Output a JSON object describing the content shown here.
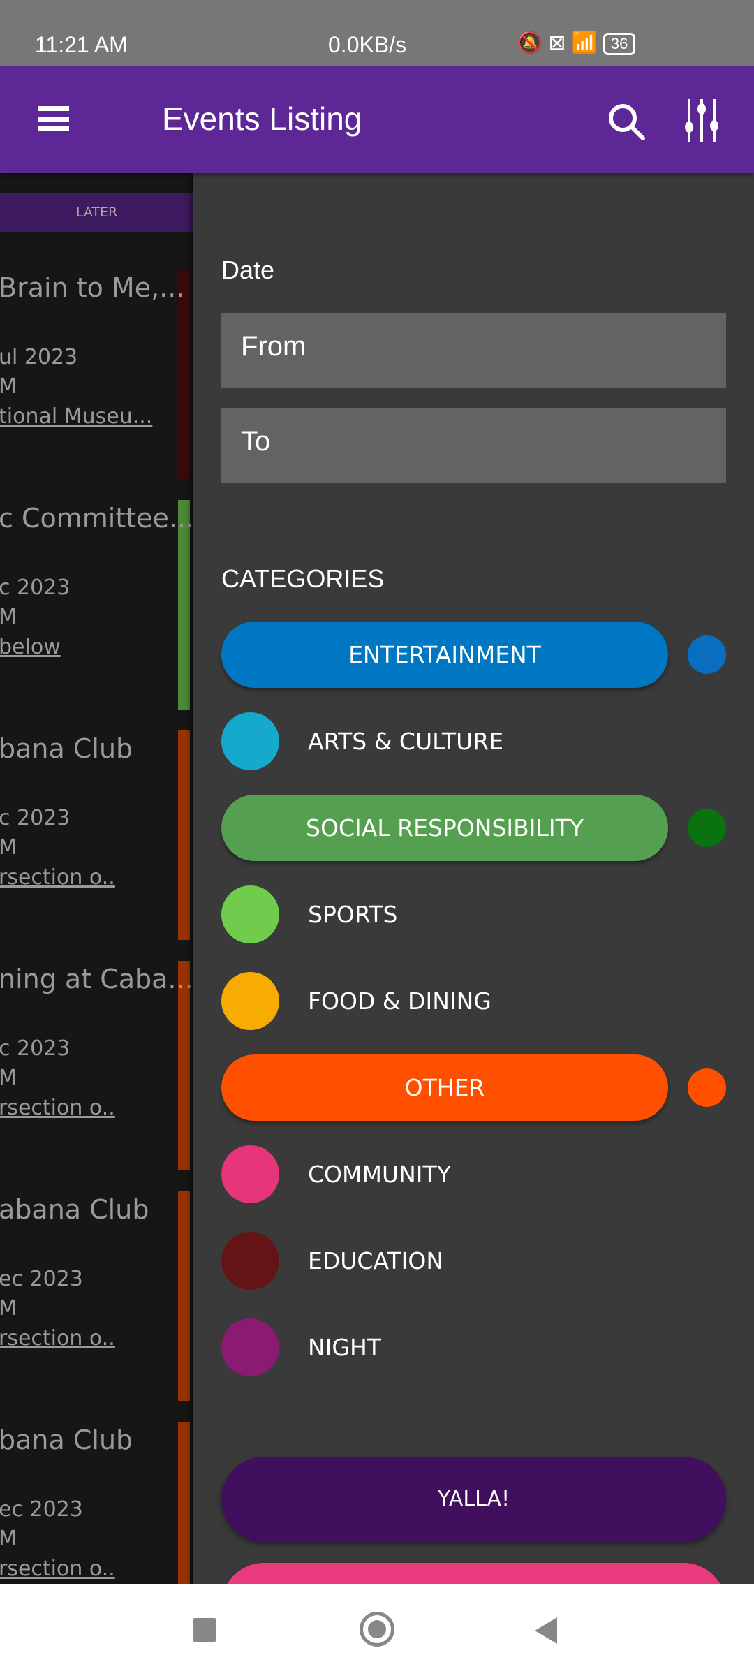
{
  "status_bar": {
    "time": "11:21 AM",
    "net_speed": "0.0KB/s",
    "battery": "36"
  },
  "app_bar": {
    "title": "Events Listing"
  },
  "list": {
    "tab": "LATER",
    "cards": [
      {
        "title": "Brain to Me,...",
        "date": "ul 2023",
        "time": "M",
        "location": "tional Museu...",
        "color": "#3a0a0a"
      },
      {
        "title": "c Committee...",
        "date": "c 2023",
        "time": "M",
        "location": "below",
        "color": "#4a8a35"
      },
      {
        "title": "bana Club",
        "date": "c 2023",
        "time": "M",
        "location": "rsection o..",
        "color": "#9a3300"
      },
      {
        "title": "ning at Caba...",
        "date": "c 2023",
        "time": "M",
        "location": "rsection o..",
        "color": "#9a3300"
      },
      {
        "title": "abana Club",
        "date": "ec 2023",
        "time": "M",
        "location": "rsection o..",
        "color": "#9a3300"
      },
      {
        "title": "bana Club",
        "date": "ec 2023",
        "time": "M",
        "location": "rsection o..",
        "color": "#9a3300"
      }
    ]
  },
  "filter": {
    "date_label": "Date",
    "from_placeholder": "From",
    "to_placeholder": "To",
    "categories_label": "CATEGORIES",
    "categories": [
      {
        "name": "ENTERTAINMENT",
        "color": "#0077c2",
        "selected": true,
        "dot": "#0a6ec0"
      },
      {
        "name": "ARTS & CULTURE",
        "color": "#15aacb",
        "selected": false
      },
      {
        "name": "SOCIAL RESPONSIBILITY",
        "color": "#54a050",
        "selected": true,
        "dot": "#0a7310"
      },
      {
        "name": "SPORTS",
        "color": "#6fcc4c",
        "selected": false
      },
      {
        "name": "FOOD & DINING",
        "color": "#f8ab00",
        "selected": false
      },
      {
        "name": "OTHER",
        "color": "#ff5000",
        "selected": true,
        "dot": "#ff5000"
      },
      {
        "name": "COMMUNITY",
        "color": "#e6357a",
        "selected": false
      },
      {
        "name": "EDUCATION",
        "color": "#641414",
        "selected": false
      },
      {
        "name": "NIGHT",
        "color": "#8a1a72",
        "selected": false
      }
    ],
    "submit_label": "YALLA!",
    "submit_color": "#40105e",
    "second_button_color": "#e93a7d"
  }
}
